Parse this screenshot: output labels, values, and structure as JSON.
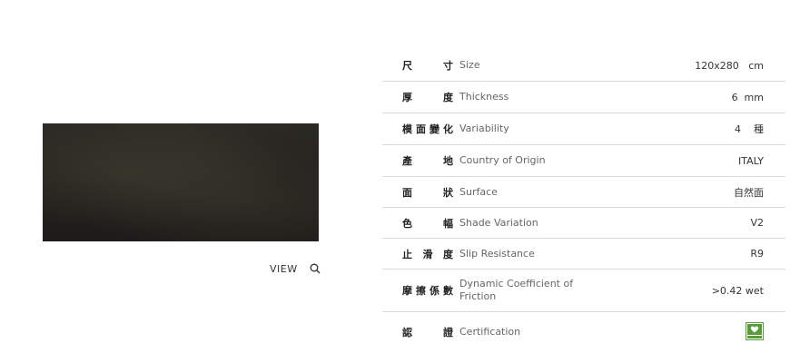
{
  "view": {
    "label": "VIEW",
    "icon": "search-icon"
  },
  "specs": [
    {
      "zh": "尺寸",
      "en": "Size",
      "value": "120x280   cm"
    },
    {
      "zh": "厚度",
      "en": "Thickness",
      "value": "6  mm"
    },
    {
      "zh": "模面變化",
      "en": "Variability",
      "value": "4    種"
    },
    {
      "zh": "產地",
      "en": "Country of Origin",
      "value": "ITALY"
    },
    {
      "zh": "面狀",
      "en": "Surface",
      "value": "自然面"
    },
    {
      "zh": "色幅",
      "en": "Shade Variation",
      "value": "V2"
    },
    {
      "zh": "止滑度",
      "en": "Slip Resistance",
      "value": "R9"
    },
    {
      "zh": "摩擦係數",
      "en": "Dynamic Coefficient of Friction",
      "value": ">0.42 wet"
    },
    {
      "zh": "認證",
      "en": "Certification",
      "value": "",
      "icon": "leed-certification-icon"
    }
  ],
  "colors": {
    "divider": "#d9d9d9",
    "leed_green": "#5a9a3a",
    "image_dark": "#23221e"
  }
}
